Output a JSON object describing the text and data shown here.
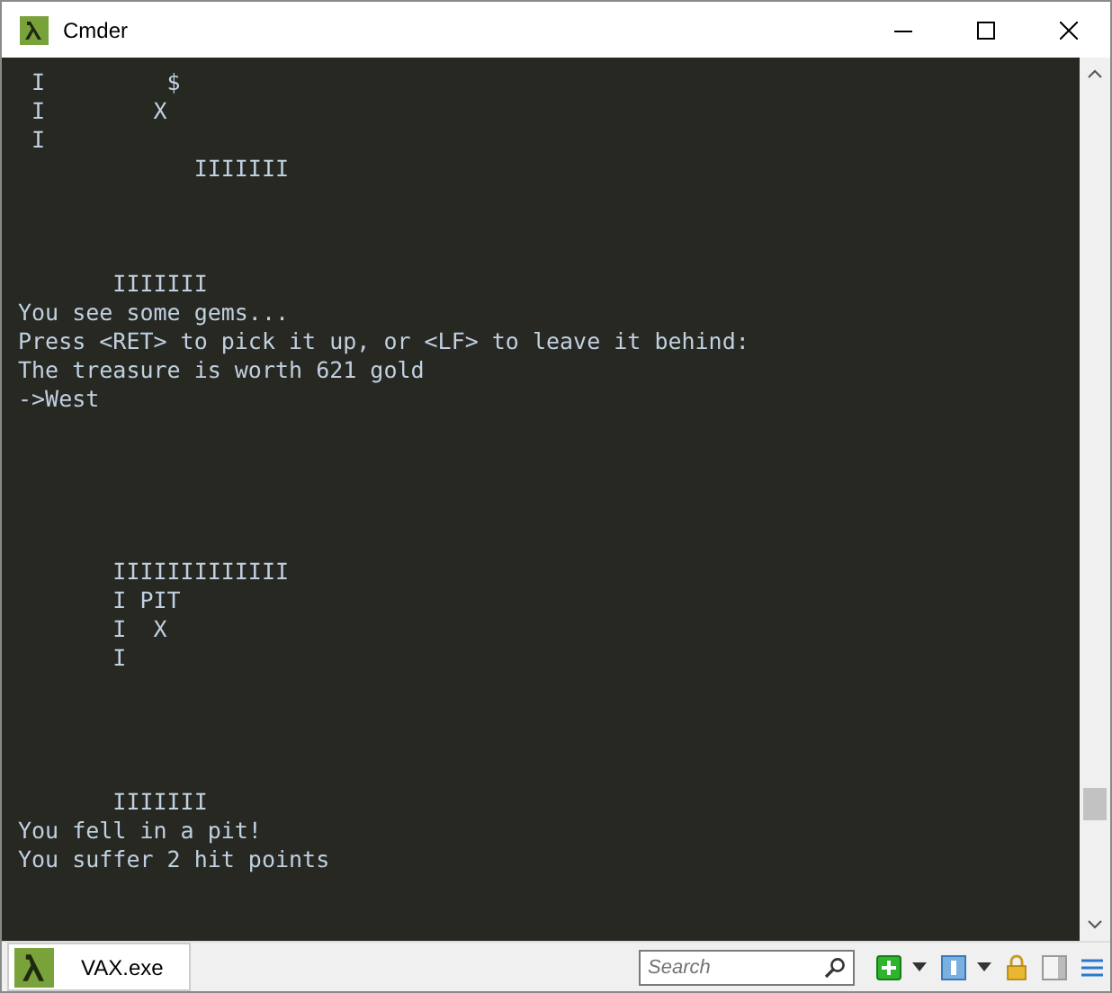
{
  "window": {
    "title": "Cmder"
  },
  "terminal": {
    "lines": [
      {
        "kind": "text",
        "text": " I         $"
      },
      {
        "kind": "text",
        "text": " I        X"
      },
      {
        "kind": "text",
        "text": " I"
      },
      {
        "kind": "text",
        "text": "             IIIIIII"
      },
      {
        "kind": "blank"
      },
      {
        "kind": "blank"
      },
      {
        "kind": "blank"
      },
      {
        "kind": "text",
        "text": "       IIIIIII"
      },
      {
        "kind": "text",
        "text": "You see some gems..."
      },
      {
        "kind": "text",
        "text": "Press <RET> to pick it up, or <LF> to leave it behind:"
      },
      {
        "kind": "text",
        "text": "The treasure is worth 621 gold"
      },
      {
        "kind": "text",
        "text": "->West"
      },
      {
        "kind": "blank"
      },
      {
        "kind": "blank"
      },
      {
        "kind": "blank"
      },
      {
        "kind": "blank"
      },
      {
        "kind": "blank"
      },
      {
        "kind": "text",
        "text": "       IIIIIIIIIIIII"
      },
      {
        "kind": "text",
        "text": "       I PIT"
      },
      {
        "kind": "text",
        "text": "       I  X"
      },
      {
        "kind": "text",
        "text": "       I"
      },
      {
        "kind": "blank"
      },
      {
        "kind": "blank"
      },
      {
        "kind": "blank"
      },
      {
        "kind": "blank"
      },
      {
        "kind": "text",
        "text": "       IIIIIII"
      },
      {
        "kind": "text",
        "text": "You fell in a pit!"
      },
      {
        "kind": "text",
        "text": "You suffer 2 hit points"
      }
    ]
  },
  "tabs": [
    {
      "label": "VAX.exe",
      "selected": true
    }
  ],
  "search": {
    "placeholder": "Search"
  }
}
